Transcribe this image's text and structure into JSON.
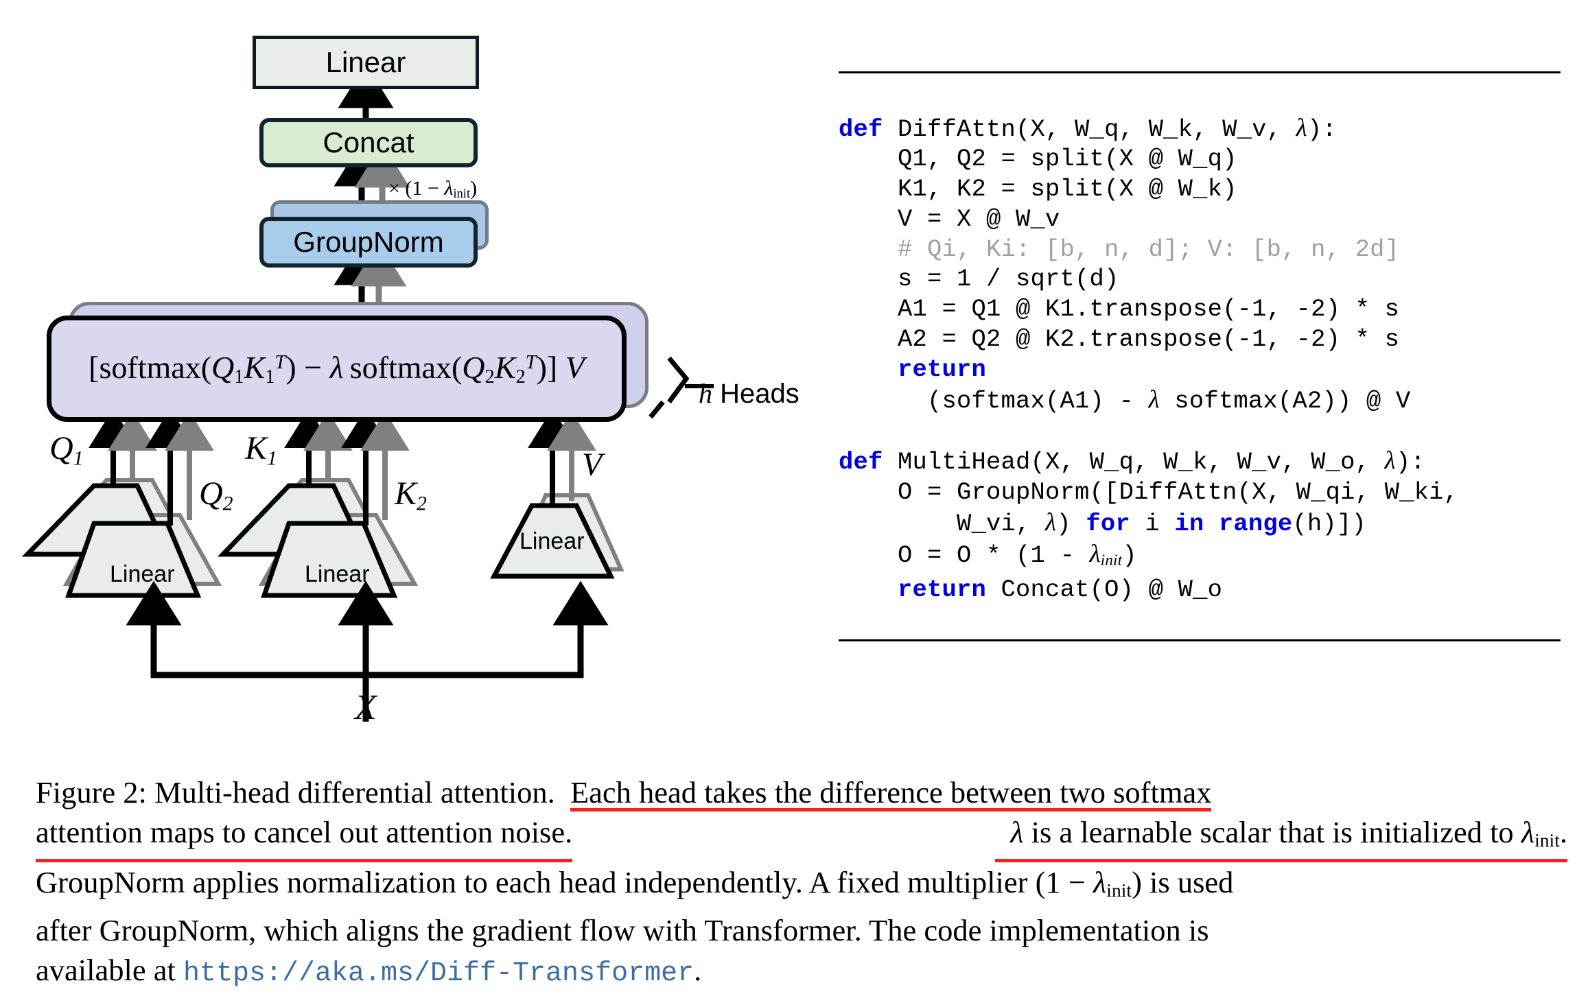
{
  "figure": {
    "diagram": {
      "top_box_label": "Linear",
      "concat_label": "Concat",
      "groupnorm_label": "GroupNorm",
      "multiplier_label": "× (1 − λinit)",
      "attention_formula": "[softmax(Q1K1T) − λ softmax(Q2K2T)] V",
      "heads_label": "h Heads",
      "linear_label": "Linear",
      "input_label": "X",
      "branch_labels": [
        "Q1",
        "Q2",
        "K1",
        "K2",
        "V"
      ],
      "colors": {
        "linear_fill": "#e8edea",
        "concat_fill": "#d9ecd0",
        "groupnorm_fill": "#a8cdec",
        "attention_fill": "#d8d9ef",
        "outline": "#10242e",
        "shadow_outline": "#7c7c86",
        "gray_arrow": "#808080",
        "black_arrow": "#000000"
      }
    },
    "code": {
      "lines": [
        {
          "indent": 0,
          "tokens": [
            {
              "t": "def",
              "c": "kw"
            },
            {
              "t": " DiffAttn(X, W_q, W_k, W_v, ",
              "c": ""
            },
            {
              "t": "λ",
              "c": "lam"
            },
            {
              "t": "):",
              "c": ""
            }
          ]
        },
        {
          "indent": 1,
          "tokens": [
            {
              "t": "Q1, Q2 = split(X @ W_q)",
              "c": ""
            }
          ]
        },
        {
          "indent": 1,
          "tokens": [
            {
              "t": "K1, K2 = split(X @ W_k)",
              "c": ""
            }
          ]
        },
        {
          "indent": 1,
          "tokens": [
            {
              "t": "V = X @ W_v",
              "c": ""
            }
          ]
        },
        {
          "indent": 1,
          "tokens": [
            {
              "t": "# Qi, Ki: [b, n, d]; V: [b, n, 2d]",
              "c": "cmt"
            }
          ]
        },
        {
          "indent": 1,
          "tokens": [
            {
              "t": "s = 1 / sqrt(d)",
              "c": ""
            }
          ]
        },
        {
          "indent": 1,
          "tokens": [
            {
              "t": "A1 = Q1 @ K1.transpose(-1, -2) * s",
              "c": ""
            }
          ]
        },
        {
          "indent": 1,
          "tokens": [
            {
              "t": "A2 = Q2 @ K2.transpose(-1, -2) * s",
              "c": ""
            }
          ]
        },
        {
          "indent": 1,
          "tokens": [
            {
              "t": "return",
              "c": "kw"
            }
          ]
        },
        {
          "indent": 2,
          "tokens": [
            {
              "t": "(softmax(A1) − ",
              "c": ""
            },
            {
              "t": "λ",
              "c": "lam"
            },
            {
              "t": " softmax(A2)) @ V",
              "c": ""
            }
          ]
        },
        {
          "indent": 0,
          "tokens": [
            {
              "t": "",
              "c": ""
            }
          ]
        },
        {
          "indent": 0,
          "tokens": [
            {
              "t": "def",
              "c": "kw"
            },
            {
              "t": " MultiHead(X, W_q, W_k, W_v, W_o, ",
              "c": ""
            },
            {
              "t": "λ",
              "c": "lam"
            },
            {
              "t": "):",
              "c": ""
            }
          ]
        },
        {
          "indent": 1,
          "tokens": [
            {
              "t": "O = GroupNorm([DiffAttn(X, W_qi, W_ki,",
              "c": ""
            }
          ]
        },
        {
          "indent": 3,
          "tokens": [
            {
              "t": "W_vi, ",
              "c": ""
            },
            {
              "t": "λ",
              "c": "lam"
            },
            {
              "t": ") ",
              "c": ""
            },
            {
              "t": "for",
              "c": "kw"
            },
            {
              "t": " i ",
              "c": ""
            },
            {
              "t": "in",
              "c": "kw"
            },
            {
              "t": " ",
              "c": ""
            },
            {
              "t": "range",
              "c": "kw"
            },
            {
              "t": "(h)])",
              "c": ""
            }
          ]
        },
        {
          "indent": 1,
          "tokens": [
            {
              "t": "O = O * (1 − ",
              "c": ""
            },
            {
              "t": "λinit",
              "c": "lamsub"
            },
            {
              "t": ")",
              "c": ""
            }
          ]
        },
        {
          "indent": 1,
          "tokens": [
            {
              "t": "return",
              "c": "kw"
            },
            {
              "t": " Concat(O) @ W_o",
              "c": ""
            }
          ]
        }
      ],
      "keyword_color": "#0000e0",
      "comment_color": "#a0a0a0"
    },
    "caption": {
      "label": "Figure 2:",
      "line1_plain": "Multi-head differential attention.",
      "line1_highlight": "Each head takes the difference between two softmax",
      "line2_highlight_a": "attention maps to cancel out attention noise.",
      "line2_highlight_b": "λ is a learnable scalar that is initialized to λinit.",
      "line3": "GroupNorm applies normalization to each head independently. A fixed multiplier (1 − λinit) is used",
      "line4": "after GroupNorm, which aligns the gradient flow with Transformer. The code implementation is",
      "line5_prefix": "available at",
      "url": "https://aka.ms/Diff-Transformer",
      "line5_suffix": ".",
      "highlight_color": "#fa1e1e",
      "url_color": "#3c6ea5"
    }
  }
}
